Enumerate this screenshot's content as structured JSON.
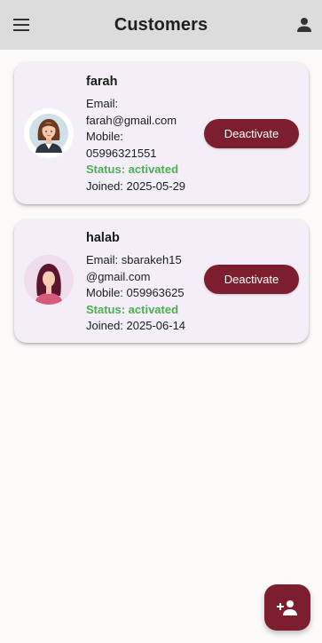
{
  "app_bar": {
    "title": "Customers",
    "menu_icon": "menu-icon",
    "profile_icon": "person-icon",
    "background": "#dcdcdc"
  },
  "customers": [
    {
      "name": "farah",
      "email_label": "Email:",
      "email": "farah@gmail.com",
      "mobile_label": "Mobile:",
      "mobile": "05996321551",
      "status": "Status: activated",
      "joined": "Joined: 2025-05-29",
      "action_label": "Deactivate",
      "avatar_icon": "woman-avatar-icon"
    },
    {
      "name": "halab",
      "email_line1": "Email: sbarakeh15",
      "email_line2": "@gmail.com",
      "mobile_line": "Mobile: 059963625",
      "status": "Status: activated",
      "joined": "Joined: 2025-06-14",
      "action_label": "Deactivate",
      "avatar_icon": "woman-avatar-icon"
    }
  ],
  "fab": {
    "icon": "add-person-icon"
  },
  "colors": {
    "accent": "#7c1e2e",
    "status_active": "#4caf50",
    "card_background": "#f3eef8",
    "page_background": "#fcfaf8"
  }
}
